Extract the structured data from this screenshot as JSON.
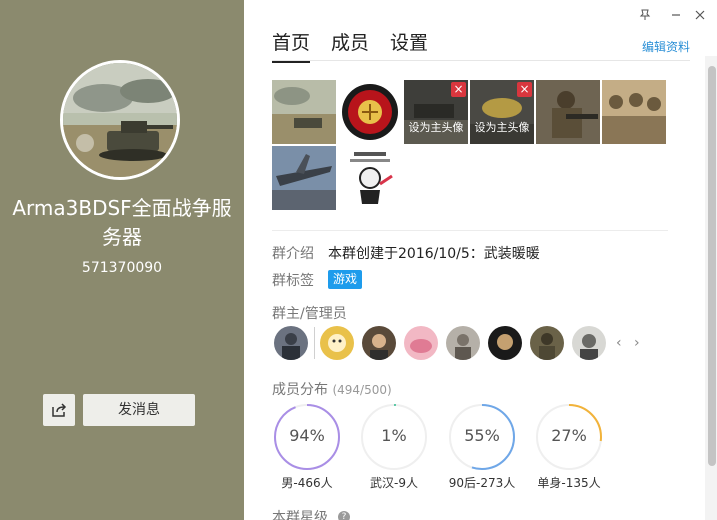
{
  "group": {
    "name": "Arma3BDSF全面战争服务器",
    "id": "571370090"
  },
  "left_actions": {
    "share_icon": "share-icon",
    "send_message_label": "发消息"
  },
  "window_controls": [
    "pin-icon",
    "minimize-icon",
    "close-icon"
  ],
  "tabs": [
    {
      "label": "首页",
      "active": true
    },
    {
      "label": "成员",
      "active": false
    },
    {
      "label": "设置",
      "active": false
    }
  ],
  "edit_profile_label": "编辑资料",
  "photos": [
    {
      "caption": "",
      "removable": false
    },
    {
      "caption": "",
      "removable": false
    },
    {
      "caption": "设为主头像",
      "removable": true
    },
    {
      "caption": "设为主头像",
      "removable": true
    },
    {
      "caption": "",
      "removable": false
    },
    {
      "caption": "",
      "removable": false
    },
    {
      "caption": "",
      "removable": false
    },
    {
      "caption": "",
      "removable": false
    }
  ],
  "intro": {
    "label": "群介绍",
    "value": "本群创建于2016/10/5：武装暖暖"
  },
  "tags": {
    "label": "群标签",
    "items": [
      "游戏"
    ]
  },
  "admins": {
    "label": "群主/管理员",
    "count": 8
  },
  "distribution": {
    "label": "成员分布",
    "count_text": "(494/500)",
    "items": [
      {
        "pct": "94%",
        "value": 0.94,
        "label": "男-466人",
        "color": "#a98ee6"
      },
      {
        "pct": "1%",
        "value": 0.01,
        "label": "武汉-9人",
        "color": "#5cc8a6"
      },
      {
        "pct": "55%",
        "value": 0.55,
        "label": "90后-273人",
        "color": "#6fa7e8"
      },
      {
        "pct": "27%",
        "value": 0.27,
        "label": "单身-135人",
        "color": "#f2b33a"
      }
    ]
  },
  "rating": {
    "label": "本群星级"
  },
  "colors": {
    "left_panel": "#8b8a6e",
    "accent": "#1e9cec",
    "link": "#2a8fd6"
  }
}
